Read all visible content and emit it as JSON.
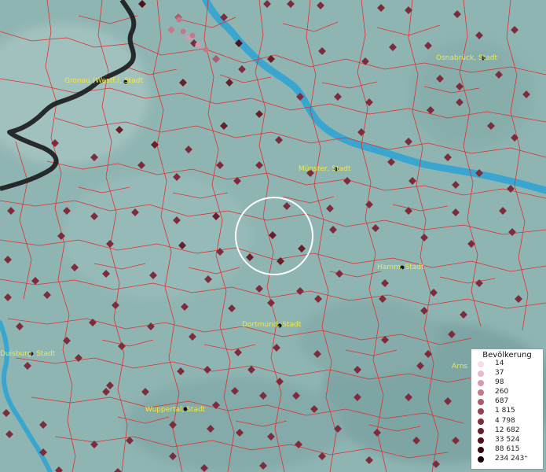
{
  "map": {
    "cities": [
      {
        "id": "gronau",
        "name": "Gronau (Westf.), Stadt"
      },
      {
        "id": "osnabrueck",
        "name": "Osnabrück, Stadt"
      },
      {
        "id": "muenster",
        "name": "Münster, Stadt"
      },
      {
        "id": "hamm",
        "name": "Hamm, Stadt"
      },
      {
        "id": "dortmund",
        "name": "Dortmund, Stadt"
      },
      {
        "id": "duisburg",
        "name": "Duisburg, Stadt"
      },
      {
        "id": "wuppertal",
        "name": "Wuppertal, Stadt"
      },
      {
        "id": "arnsberg",
        "name": "Arns"
      }
    ],
    "colors": {
      "terrain": "#8fb5b3",
      "water": "#3aa6cf",
      "boundary": "#e0302e",
      "national_border": "#1a1a1a",
      "label": "#f0e84a",
      "focus_ring": "#ffffff"
    }
  },
  "legend": {
    "title": "Bevölkerung",
    "items": [
      {
        "label": "14",
        "color": "#f6dde6"
      },
      {
        "label": "37",
        "color": "#eab9c8"
      },
      {
        "label": "98",
        "color": "#d899ab"
      },
      {
        "label": "260",
        "color": "#c27a8b"
      },
      {
        "label": "687",
        "color": "#ad5a6c"
      },
      {
        "label": "1 815",
        "color": "#973f52"
      },
      {
        "label": "4 798",
        "color": "#7e2c3b"
      },
      {
        "label": "12 682",
        "color": "#662029"
      },
      {
        "label": "33 524",
        "color": "#4c131a"
      },
      {
        "label": "88 615",
        "color": "#33090e"
      },
      {
        "label": "234 243⁺",
        "color": "#1a0405"
      }
    ]
  }
}
